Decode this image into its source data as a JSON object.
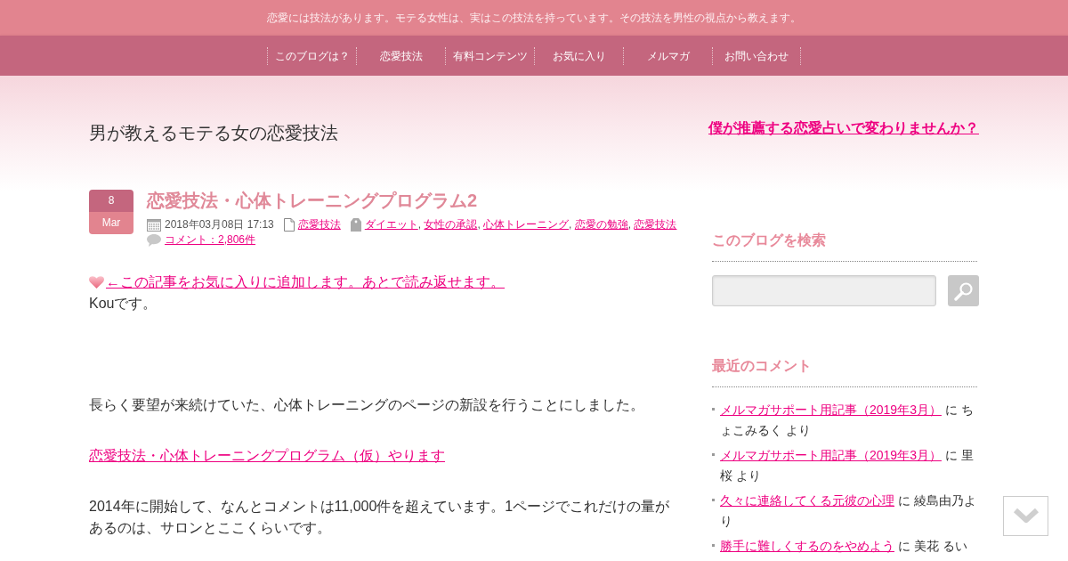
{
  "tagline": "恋愛には技法があります。モテる女性は、実はこの技法を持っています。その技法を男性の視点から教えます。",
  "nav": [
    {
      "label": "このブログは？"
    },
    {
      "label": "恋愛技法"
    },
    {
      "label": "有料コンテンツ"
    },
    {
      "label": "お気に入り"
    },
    {
      "label": "メルマガ"
    },
    {
      "label": "お問い合わせ"
    }
  ],
  "header": {
    "site_title": "男が教えるモテる女の恋愛技法",
    "promo_link": "僕が推薦する恋愛占いで変わりませんか？"
  },
  "post": {
    "date": {
      "day": "8",
      "month": "Mar"
    },
    "title": "恋愛技法・心体トレーニングプログラム2",
    "meta": {
      "datetime": "2018年03月08日 17:13",
      "category": "恋愛技法",
      "tags": [
        "ダイエット",
        "女性の承認",
        "心体トレーニング",
        "恋愛の勉強",
        "恋愛技法"
      ],
      "tag_separator": ",",
      "comments": "コメント：2,806件"
    },
    "body": [
      {
        "kind": "favorite",
        "link": "←この記事をお気に入りに追加します。あとで読み返せます。",
        "text": "Kouです。"
      },
      {
        "kind": "text",
        "text": "長らく要望が来続けていた、心体トレーニングのページの新設を行うことにしました。"
      },
      {
        "kind": "link",
        "text": "恋愛技法・心体トレーニングプログラム（仮）やります"
      },
      {
        "kind": "text",
        "text": "2014年に開始して、なんとコメントは11,000件を超えています。1ページでこれだけの量があるのは、サロンとここくらいです。"
      }
    ]
  },
  "sidebar": {
    "search": {
      "title": "このブログを検索"
    },
    "recent_comments": {
      "title": "最近のコメント",
      "items": [
        {
          "post": "メルマガサポート用記事（2019年3月）",
          "note": "に ちょこみるく より"
        },
        {
          "post": "メルマガサポート用記事（2019年3月）",
          "note": "に 里桜 より"
        },
        {
          "post": "久々に連絡してくる元彼の心理",
          "note": "に 綾島由乃より"
        },
        {
          "post": "勝手に難しくするのをやめよう",
          "note": "に 美花 るい"
        }
      ]
    }
  }
}
